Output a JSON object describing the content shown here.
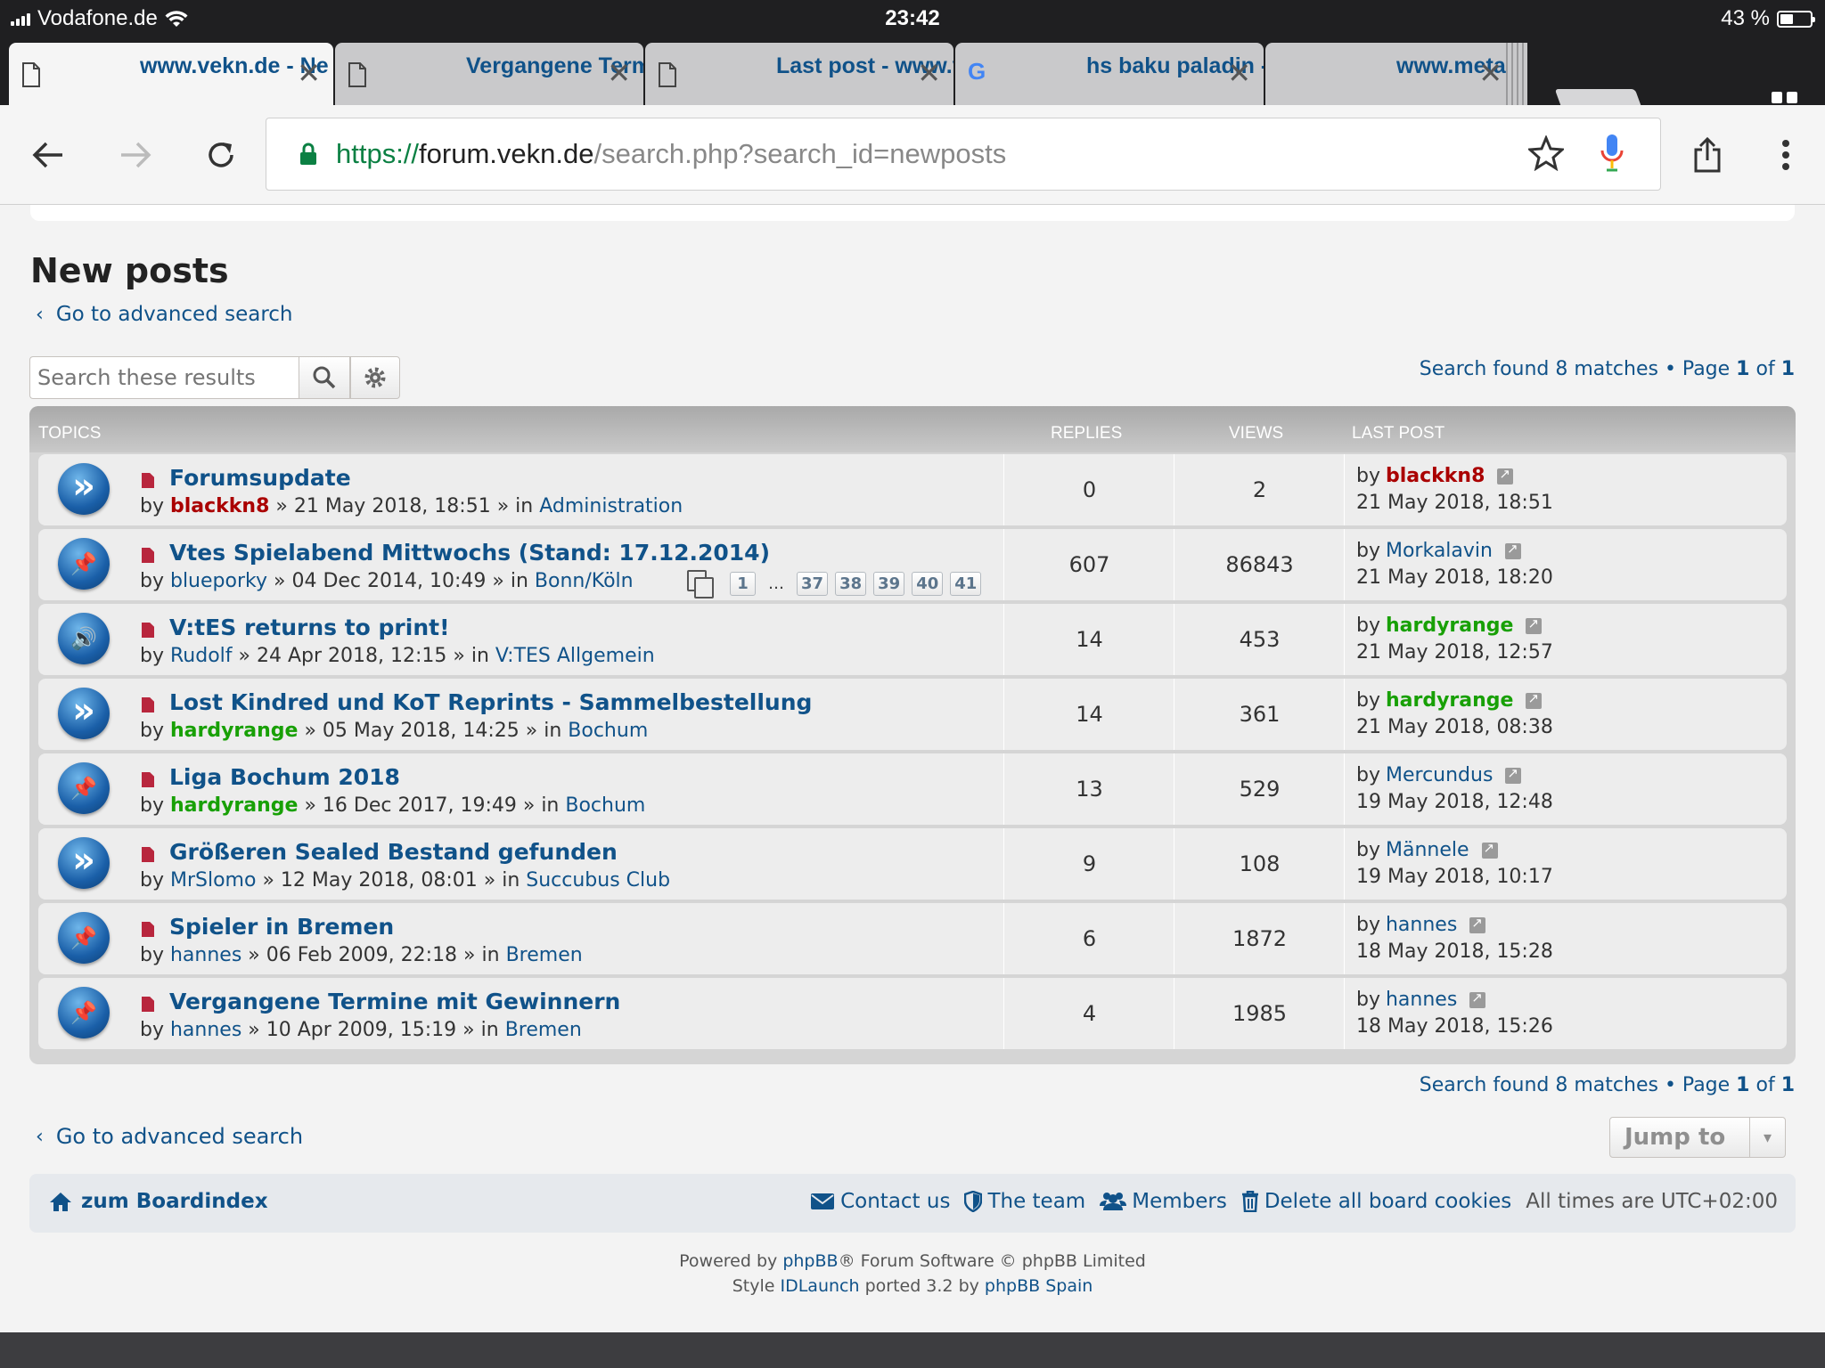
{
  "status_bar": {
    "carrier": "Vodafone.de",
    "time": "23:42",
    "battery": "43 %",
    "battery_level": 0.43
  },
  "tabs": [
    {
      "title": "www.vekn.de - Ne",
      "icon": "page-icon",
      "active": true
    },
    {
      "title": "Vergangene Termi",
      "icon": "page-icon",
      "active": false
    },
    {
      "title": "Last post - www.v",
      "icon": "page-icon",
      "active": false
    },
    {
      "title": "hs baku paladin -",
      "icon": "google-icon",
      "active": false
    },
    {
      "title": "www.metabomb.",
      "icon": "page-icon",
      "active": false
    }
  ],
  "url": {
    "scheme": "https://",
    "host": "forum.vekn.de",
    "path": "/search.php?search_id=newposts"
  },
  "page": {
    "title": "New posts",
    "advanced_search": "Go to advanced search",
    "search_placeholder": "Search these results",
    "pagination": {
      "prefix": "Search found 8 matches • Page ",
      "current": "1",
      "mid": " of ",
      "total": "1"
    }
  },
  "table": {
    "headers": {
      "topics": "TOPICS",
      "replies": "REPLIES",
      "views": "VIEWS",
      "last_post": "LAST POST"
    },
    "rows": [
      {
        "icon": "arrow-icon",
        "title": "Forumsupdate",
        "author": "blackkn8",
        "author_color": "red",
        "date": "21 May 2018, 18:51",
        "forum": "Administration",
        "replies": "0",
        "views": "2",
        "last_by": "blackkn8",
        "last_by_color": "red",
        "last_date": "21 May 2018, 18:51"
      },
      {
        "icon": "pin-icon",
        "title": "Vtes Spielabend Mittwochs (Stand: 17.12.2014)",
        "author": "blueporky",
        "author_color": "plain",
        "date": "04 Dec 2014, 10:49",
        "forum": "Bonn/Köln",
        "replies": "607",
        "views": "86843",
        "last_by": "Morkalavin",
        "last_by_color": "plain",
        "last_date": "21 May 2018, 18:20",
        "pages": [
          "1",
          "…",
          "37",
          "38",
          "39",
          "40",
          "41"
        ]
      },
      {
        "icon": "speaker-icon",
        "title": "V:tES returns to print!",
        "author": "Rudolf",
        "author_color": "plain",
        "date": "24 Apr 2018, 12:15",
        "forum": "V:TES Allgemein",
        "replies": "14",
        "views": "453",
        "last_by": "hardyrange",
        "last_by_color": "green",
        "last_date": "21 May 2018, 12:57"
      },
      {
        "icon": "arrow-icon",
        "title": "Lost Kindred und KoT Reprints - Sammelbestellung",
        "author": "hardyrange",
        "author_color": "green",
        "date": "05 May 2018, 14:25",
        "forum": "Bochum",
        "replies": "14",
        "views": "361",
        "last_by": "hardyrange",
        "last_by_color": "green",
        "last_date": "21 May 2018, 08:38"
      },
      {
        "icon": "pin-icon",
        "title": "Liga Bochum 2018",
        "author": "hardyrange",
        "author_color": "green",
        "date": "16 Dec 2017, 19:49",
        "forum": "Bochum",
        "replies": "13",
        "views": "529",
        "last_by": "Mercundus",
        "last_by_color": "plain",
        "last_date": "19 May 2018, 12:48"
      },
      {
        "icon": "arrow-icon",
        "title": "Größeren Sealed Bestand gefunden",
        "author": "MrSlomo",
        "author_color": "plain",
        "date": "12 May 2018, 08:01",
        "forum": "Succubus Club",
        "replies": "9",
        "views": "108",
        "last_by": "Männele",
        "last_by_color": "plain",
        "last_date": "19 May 2018, 10:17"
      },
      {
        "icon": "pin-icon",
        "title": "Spieler in Bremen",
        "author": "hannes",
        "author_color": "plain",
        "date": "06 Feb 2009, 22:18",
        "forum": "Bremen",
        "replies": "6",
        "views": "1872",
        "last_by": "hannes",
        "last_by_color": "plain",
        "last_date": "18 May 2018, 15:28"
      },
      {
        "icon": "pin-icon",
        "title": "Vergangene Termine mit Gewinnern",
        "author": "hannes",
        "author_color": "plain",
        "date": "10 Apr 2009, 15:19",
        "forum": "Bremen",
        "replies": "4",
        "views": "1985",
        "last_by": "hannes",
        "last_by_color": "plain",
        "last_date": "18 May 2018, 15:26"
      }
    ],
    "by_label": "by",
    "in_label": "in"
  },
  "jump_to": "Jump to",
  "footer_nav": {
    "home": "zum Boardindex",
    "contact": "Contact us",
    "team": "The team",
    "members": "Members",
    "delete_cookies": "Delete all board cookies",
    "timezone": "All times are UTC+02:00"
  },
  "copyright": {
    "powered_prefix": "Powered by ",
    "phpbb": "phpBB",
    "powered_suffix": "® Forum Software © phpBB Limited",
    "style_prefix": "Style ",
    "style_name": "IDLaunch",
    "style_mid": " ported 3.2 by ",
    "style_author": "phpBB Spain"
  },
  "colors": {
    "link": "#105289",
    "user_red": "#aa0000",
    "user_green": "#18a005",
    "unread_icon": "#b8263d"
  }
}
